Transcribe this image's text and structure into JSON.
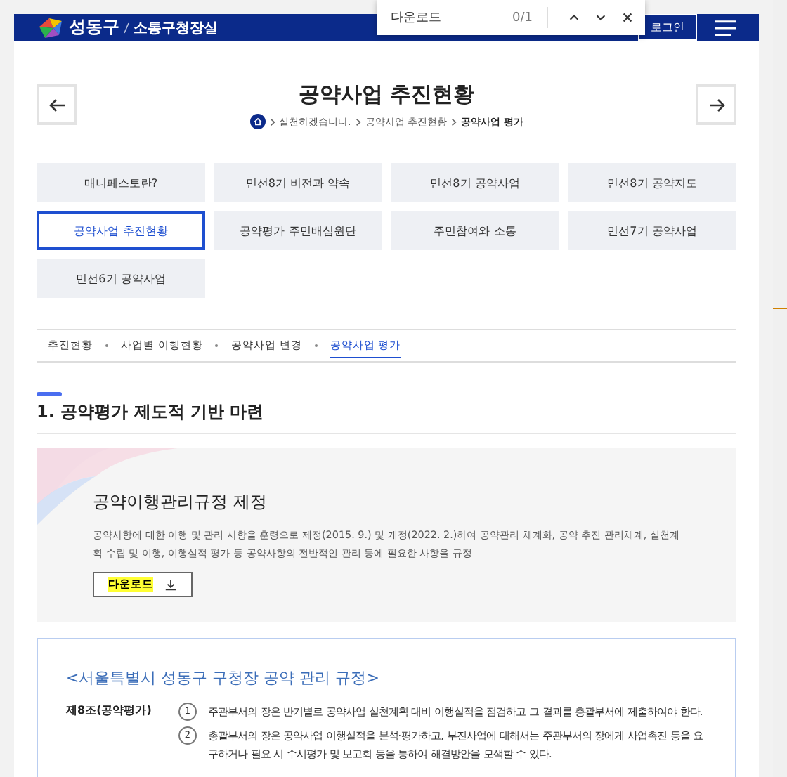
{
  "find_bar": {
    "query": "다운로드",
    "count": "0/1"
  },
  "header": {
    "logo": "성동구",
    "logo_sub": "소통구청장실",
    "login": "로그인"
  },
  "page": {
    "title": "공약사업 추진현황",
    "breadcrumb": [
      "실천하겠습니다.",
      "공약사업 추진현황",
      "공약사업 평가"
    ]
  },
  "menu": [
    {
      "label": "매니페스토란?",
      "selected": false
    },
    {
      "label": "민선8기 비전과 약속",
      "selected": false
    },
    {
      "label": "민선8기 공약사업",
      "selected": false
    },
    {
      "label": "민선8기 공약지도",
      "selected": false
    },
    {
      "label": "공약사업 추진현황",
      "selected": true
    },
    {
      "label": "공약평가 주민배심원단",
      "selected": false
    },
    {
      "label": "주민참여와 소통",
      "selected": false
    },
    {
      "label": "민선7기 공약사업",
      "selected": false
    },
    {
      "label": "민선6기 공약사업",
      "selected": false
    }
  ],
  "sub_tabs": [
    {
      "label": "추진현황",
      "selected": false
    },
    {
      "label": "사업별 이행현황",
      "selected": false
    },
    {
      "label": "공약사업 변경",
      "selected": false
    },
    {
      "label": "공약사업 평가",
      "selected": true
    }
  ],
  "section": {
    "heading": "1. 공약평가 제도적 기반 마련",
    "card": {
      "title": "공약이행관리규정 제정",
      "description": "공약사항에 대한 이행 및 관리 사항을 훈령으로 제정(2015. 9.) 및 개정(2022. 2.)하여 공약관리 체계화, 공약 추진 관리체계, 실천계획 수립 및 이행, 이행실적 평가 등 공약사항의 전반적인 관리 등에 필요한 사항을 규정",
      "button": "다운로드",
      "button_highlighted": true
    },
    "regulation": {
      "title": "<서울특별시 성동구 구청장 공약 관리 규정>",
      "articles": [
        {
          "label": "제8조(공약평가)",
          "items": [
            {
              "num": "1",
              "text": "주관부서의 장은 반기별로 공약사업 실천계획 대비 이행실적을 점검하고 그 결과를 총괄부서에 제출하여야 한다."
            },
            {
              "num": "2",
              "text": "총괄부서의 장은 공약사업 이행실적을 분석·평가하고, 부진사업에 대해서는 주관부서의 장에게 사업촉진 등을 요구하거나 필요 시 수시평가 및 보고회 등을 통하여 해결방안을 모색할 수 있다."
            }
          ]
        }
      ]
    }
  }
}
